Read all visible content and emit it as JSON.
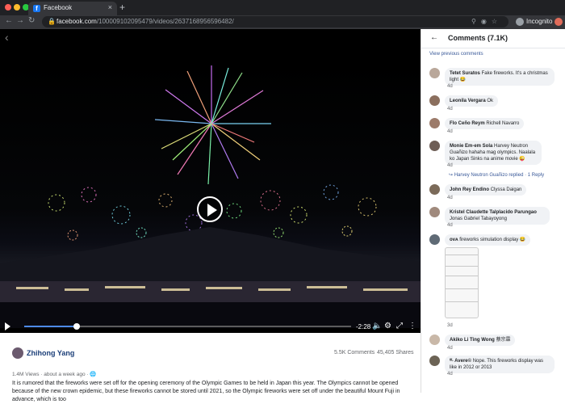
{
  "browser": {
    "tab_title": "Facebook",
    "tab_favicon": "f",
    "tab_close": "×",
    "new_tab": "+",
    "url_domain": "facebook.com",
    "url_path": "/100009102095479/videos/2637168956596482/",
    "profile_label": "Incognito",
    "icons": [
      "back-arrow-icon",
      "forward-arrow-icon",
      "reload-icon",
      "lock-icon",
      "key-icon",
      "eye-slash-icon",
      "star-icon",
      "incognito-icon"
    ]
  },
  "video": {
    "time_remaining": "-2:28",
    "progress_fraction": 0.16,
    "icons": [
      "back-chevron-icon",
      "play-icon",
      "volume-icon",
      "settings-icon",
      "fullscreen-icon",
      "more-icon"
    ]
  },
  "post": {
    "author": "Zhihong Yang",
    "comments_count": "5.5K Comments",
    "shares_count": "45,405 Shares",
    "meta": "1.4M Views · about a week ago · ",
    "caption": "It is rumored that the fireworks were set off for the opening ceremony of the Olympic Games to be held in Japan this year. The Olympics cannot be opened because of the new crown epidemic, but these fireworks cannot be stored until 2021, so the Olympic fireworks were set off under the beautiful Mount Fuji in advance, which is too"
  },
  "comments_panel": {
    "title": "Comments (7.1K)",
    "view_previous": "View previous comments",
    "comments": [
      {
        "name": "Tetet Suratos",
        "text": "Fake fireworks. It's a christmas light 😂",
        "time": "4d",
        "avatar_color": "#b9a79a"
      },
      {
        "name": "Leonila Vergara",
        "text": "Ok",
        "time": "4d",
        "avatar_color": "#8b6f5e"
      },
      {
        "name": "Flo Ceño Reym",
        "text": "Richell Navarro",
        "time": "4d",
        "avatar_color": "#9c7b6a"
      },
      {
        "name": "Monie Em-em Sola",
        "text": "Harvey Neutron Guañizo hahaha mag olympics. Naalala ko Japan Sinks na anime movie 😜",
        "time": "4d",
        "avatar_color": "#6e5e56",
        "reply": "Harvey Neutron Guañizo replied · 1 Reply"
      },
      {
        "name": "John Rey Endino",
        "text": "Clyssa Daigan",
        "time": "4d",
        "avatar_color": "#7b6a59"
      },
      {
        "name": "Kristel Claudette Talplacido Parungao",
        "text": "Jonas Gabriel Tabayoyong",
        "time": "4d",
        "avatar_color": "#a08a7d"
      },
      {
        "name": "ᴏᴠᴀ",
        "text": "fireworks simulation display 😂",
        "time": "3d",
        "avatar_color": "#5f6a75"
      },
      {
        "name": "Akiko Li Ting Wong",
        "text": "蔡宗霖",
        "time": "4d",
        "avatar_color": "#c9b8a8"
      },
      {
        "name": "ᵗᴵᴸ Avere©",
        "text": "Nope. This fireworks display was like in 2012 or 2013",
        "time": "4d",
        "avatar_color": "#6c6355"
      }
    ]
  }
}
